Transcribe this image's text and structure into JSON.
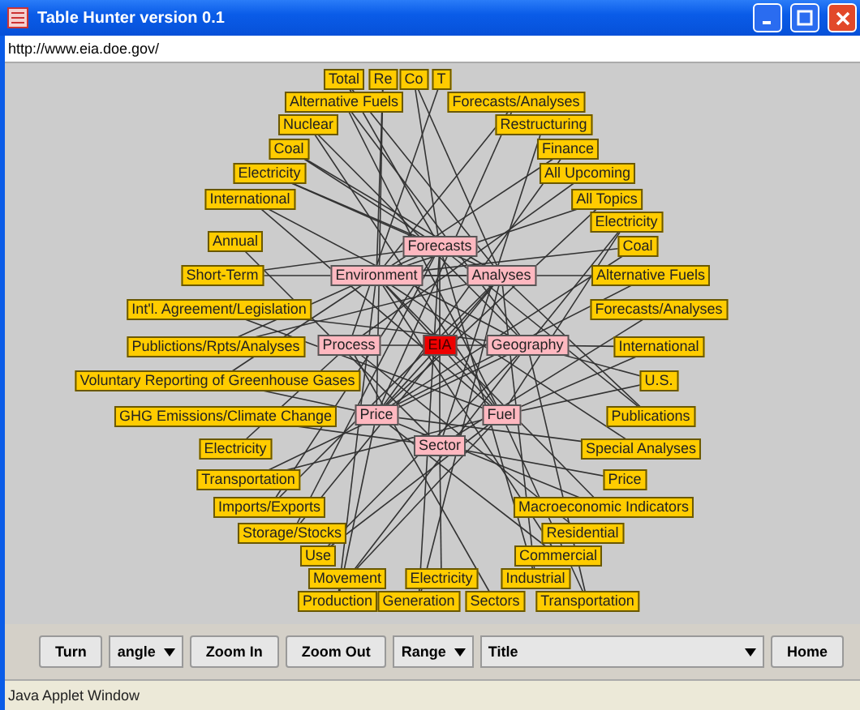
{
  "window": {
    "title": "Table Hunter version 0.1"
  },
  "address": "http://www.eia.doe.gov/",
  "graph": {
    "nodes": [
      {
        "label": "Total",
        "kind": "leaf"
      },
      {
        "label": "Re",
        "kind": "leaf"
      },
      {
        "label": "Co",
        "kind": "leaf"
      },
      {
        "label": "T",
        "kind": "leaf"
      },
      {
        "label": "Alternative Fuels",
        "kind": "leaf"
      },
      {
        "label": "Forecasts/Analyses",
        "kind": "leaf"
      },
      {
        "label": "Nuclear",
        "kind": "leaf"
      },
      {
        "label": "Restructuring",
        "kind": "leaf"
      },
      {
        "label": "Coal",
        "kind": "leaf"
      },
      {
        "label": "Finance",
        "kind": "leaf"
      },
      {
        "label": "Electricity",
        "kind": "leaf"
      },
      {
        "label": "All Upcoming",
        "kind": "leaf"
      },
      {
        "label": "International",
        "kind": "leaf"
      },
      {
        "label": "All Topics",
        "kind": "leaf"
      },
      {
        "label": "Electricity",
        "kind": "leaf"
      },
      {
        "label": "Annual",
        "kind": "leaf"
      },
      {
        "label": "Forecasts",
        "kind": "hub"
      },
      {
        "label": "Coal",
        "kind": "leaf"
      },
      {
        "label": "Short-Term",
        "kind": "leaf"
      },
      {
        "label": "Environment",
        "kind": "hub"
      },
      {
        "label": "Analyses",
        "kind": "hub"
      },
      {
        "label": "Alternative Fuels",
        "kind": "leaf"
      },
      {
        "label": "Int'l. Agreement/Legislation",
        "kind": "leaf"
      },
      {
        "label": "Forecasts/Analyses",
        "kind": "leaf"
      },
      {
        "label": "Publictions/Rpts/Analyses",
        "kind": "leaf"
      },
      {
        "label": "Process",
        "kind": "hub"
      },
      {
        "label": "EIA",
        "kind": "root"
      },
      {
        "label": "Geography",
        "kind": "hub"
      },
      {
        "label": "International",
        "kind": "leaf"
      },
      {
        "label": "Voluntary Reporting of Greenhouse Gases",
        "kind": "leaf"
      },
      {
        "label": "U.S.",
        "kind": "leaf"
      },
      {
        "label": "GHG Emissions/Climate Change",
        "kind": "leaf"
      },
      {
        "label": "Price",
        "kind": "hub"
      },
      {
        "label": "Fuel",
        "kind": "hub"
      },
      {
        "label": "Publications",
        "kind": "leaf"
      },
      {
        "label": "Electricity",
        "kind": "leaf"
      },
      {
        "label": "Sector",
        "kind": "hub"
      },
      {
        "label": "Special Analyses",
        "kind": "leaf"
      },
      {
        "label": "Transportation",
        "kind": "leaf"
      },
      {
        "label": "Price",
        "kind": "leaf"
      },
      {
        "label": "Imports/Exports",
        "kind": "leaf"
      },
      {
        "label": "Macroeconomic Indicators",
        "kind": "leaf"
      },
      {
        "label": "Storage/Stocks",
        "kind": "leaf"
      },
      {
        "label": "Residential",
        "kind": "leaf"
      },
      {
        "label": "Use",
        "kind": "leaf"
      },
      {
        "label": "Commercial",
        "kind": "leaf"
      },
      {
        "label": "Movement",
        "kind": "leaf"
      },
      {
        "label": "Electricity",
        "kind": "leaf"
      },
      {
        "label": "Industrial",
        "kind": "leaf"
      },
      {
        "label": "Production",
        "kind": "leaf"
      },
      {
        "label": "Generation",
        "kind": "leaf"
      },
      {
        "label": "Sectors",
        "kind": "leaf"
      },
      {
        "label": "Transportation",
        "kind": "leaf"
      }
    ]
  },
  "toolbar": [
    {
      "kind": "button",
      "label": "Turn"
    },
    {
      "kind": "dropdown",
      "label": "angle"
    },
    {
      "kind": "button",
      "label": "Zoom In"
    },
    {
      "kind": "button",
      "label": "Zoom Out"
    },
    {
      "kind": "dropdown",
      "label": "Range"
    },
    {
      "kind": "wide-dropdown",
      "label": "Title"
    },
    {
      "kind": "button",
      "label": "Home"
    }
  ],
  "status_bar": "Java Applet Window"
}
